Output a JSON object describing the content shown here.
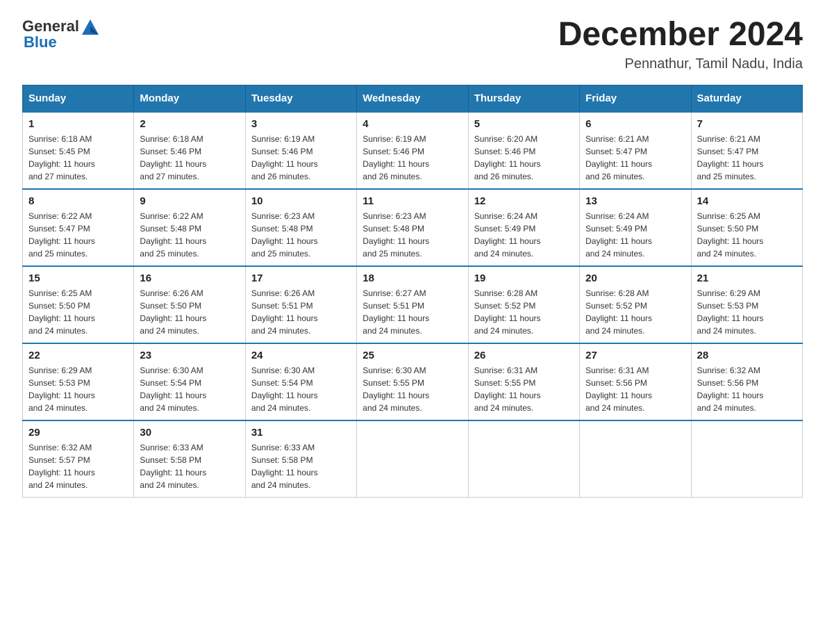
{
  "header": {
    "logo_general": "General",
    "logo_blue": "Blue",
    "month_title": "December 2024",
    "location": "Pennathur, Tamil Nadu, India"
  },
  "weekdays": [
    "Sunday",
    "Monday",
    "Tuesday",
    "Wednesday",
    "Thursday",
    "Friday",
    "Saturday"
  ],
  "weeks": [
    [
      {
        "day": "1",
        "sunrise": "6:18 AM",
        "sunset": "5:45 PM",
        "daylight": "11 hours and 27 minutes."
      },
      {
        "day": "2",
        "sunrise": "6:18 AM",
        "sunset": "5:46 PM",
        "daylight": "11 hours and 27 minutes."
      },
      {
        "day": "3",
        "sunrise": "6:19 AM",
        "sunset": "5:46 PM",
        "daylight": "11 hours and 26 minutes."
      },
      {
        "day": "4",
        "sunrise": "6:19 AM",
        "sunset": "5:46 PM",
        "daylight": "11 hours and 26 minutes."
      },
      {
        "day": "5",
        "sunrise": "6:20 AM",
        "sunset": "5:46 PM",
        "daylight": "11 hours and 26 minutes."
      },
      {
        "day": "6",
        "sunrise": "6:21 AM",
        "sunset": "5:47 PM",
        "daylight": "11 hours and 26 minutes."
      },
      {
        "day": "7",
        "sunrise": "6:21 AM",
        "sunset": "5:47 PM",
        "daylight": "11 hours and 25 minutes."
      }
    ],
    [
      {
        "day": "8",
        "sunrise": "6:22 AM",
        "sunset": "5:47 PM",
        "daylight": "11 hours and 25 minutes."
      },
      {
        "day": "9",
        "sunrise": "6:22 AM",
        "sunset": "5:48 PM",
        "daylight": "11 hours and 25 minutes."
      },
      {
        "day": "10",
        "sunrise": "6:23 AM",
        "sunset": "5:48 PM",
        "daylight": "11 hours and 25 minutes."
      },
      {
        "day": "11",
        "sunrise": "6:23 AM",
        "sunset": "5:48 PM",
        "daylight": "11 hours and 25 minutes."
      },
      {
        "day": "12",
        "sunrise": "6:24 AM",
        "sunset": "5:49 PM",
        "daylight": "11 hours and 24 minutes."
      },
      {
        "day": "13",
        "sunrise": "6:24 AM",
        "sunset": "5:49 PM",
        "daylight": "11 hours and 24 minutes."
      },
      {
        "day": "14",
        "sunrise": "6:25 AM",
        "sunset": "5:50 PM",
        "daylight": "11 hours and 24 minutes."
      }
    ],
    [
      {
        "day": "15",
        "sunrise": "6:25 AM",
        "sunset": "5:50 PM",
        "daylight": "11 hours and 24 minutes."
      },
      {
        "day": "16",
        "sunrise": "6:26 AM",
        "sunset": "5:50 PM",
        "daylight": "11 hours and 24 minutes."
      },
      {
        "day": "17",
        "sunrise": "6:26 AM",
        "sunset": "5:51 PM",
        "daylight": "11 hours and 24 minutes."
      },
      {
        "day": "18",
        "sunrise": "6:27 AM",
        "sunset": "5:51 PM",
        "daylight": "11 hours and 24 minutes."
      },
      {
        "day": "19",
        "sunrise": "6:28 AM",
        "sunset": "5:52 PM",
        "daylight": "11 hours and 24 minutes."
      },
      {
        "day": "20",
        "sunrise": "6:28 AM",
        "sunset": "5:52 PM",
        "daylight": "11 hours and 24 minutes."
      },
      {
        "day": "21",
        "sunrise": "6:29 AM",
        "sunset": "5:53 PM",
        "daylight": "11 hours and 24 minutes."
      }
    ],
    [
      {
        "day": "22",
        "sunrise": "6:29 AM",
        "sunset": "5:53 PM",
        "daylight": "11 hours and 24 minutes."
      },
      {
        "day": "23",
        "sunrise": "6:30 AM",
        "sunset": "5:54 PM",
        "daylight": "11 hours and 24 minutes."
      },
      {
        "day": "24",
        "sunrise": "6:30 AM",
        "sunset": "5:54 PM",
        "daylight": "11 hours and 24 minutes."
      },
      {
        "day": "25",
        "sunrise": "6:30 AM",
        "sunset": "5:55 PM",
        "daylight": "11 hours and 24 minutes."
      },
      {
        "day": "26",
        "sunrise": "6:31 AM",
        "sunset": "5:55 PM",
        "daylight": "11 hours and 24 minutes."
      },
      {
        "day": "27",
        "sunrise": "6:31 AM",
        "sunset": "5:56 PM",
        "daylight": "11 hours and 24 minutes."
      },
      {
        "day": "28",
        "sunrise": "6:32 AM",
        "sunset": "5:56 PM",
        "daylight": "11 hours and 24 minutes."
      }
    ],
    [
      {
        "day": "29",
        "sunrise": "6:32 AM",
        "sunset": "5:57 PM",
        "daylight": "11 hours and 24 minutes."
      },
      {
        "day": "30",
        "sunrise": "6:33 AM",
        "sunset": "5:58 PM",
        "daylight": "11 hours and 24 minutes."
      },
      {
        "day": "31",
        "sunrise": "6:33 AM",
        "sunset": "5:58 PM",
        "daylight": "11 hours and 24 minutes."
      },
      null,
      null,
      null,
      null
    ]
  ],
  "labels": {
    "sunrise": "Sunrise:",
    "sunset": "Sunset:",
    "daylight": "Daylight:"
  },
  "accent_color": "#2176ae"
}
